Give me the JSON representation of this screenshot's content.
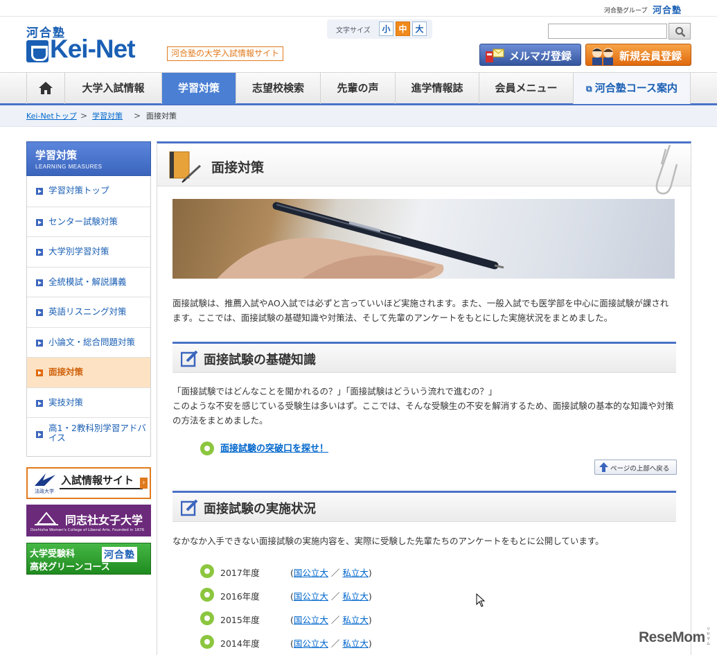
{
  "header": {
    "group_label": "河合塾グループ",
    "group_logo": "河合塾",
    "brand_top": "河合塾",
    "brand_name": "Kei-Net",
    "tagline": "河合塾の大学入試情報サイト",
    "font_size": {
      "label": "文字サイズ",
      "small": "小",
      "medium": "中",
      "large": "大",
      "selected": "中"
    },
    "search": {
      "value": "",
      "placeholder": "",
      "icon": "search-icon"
    },
    "mailmag_label": "メルマガ登録",
    "join_label": "新規会員登録"
  },
  "nav": {
    "home_icon": "home-icon",
    "items": [
      "大学入試情報",
      "学習対策",
      "志望校検索",
      "先輩の声",
      "進学情報誌",
      "会員メニュー",
      "河合塾コース案内"
    ],
    "active": "学習対策"
  },
  "breadcrumb": {
    "home": "Kei-Netトップ",
    "parent": "学習対策",
    "current": "面接対策",
    "separator": ">"
  },
  "sidebar": {
    "title": "学習対策",
    "subtitle": "LEARNING MEASURES",
    "items": [
      "学習対策トップ",
      "センター試験対策",
      "大学別学習対策",
      "全統模試・解説講義",
      "英語リスニング対策",
      "小論文・総合問題対策",
      "面接対策",
      "実技対策",
      "高1・2教科別学習アドバイス"
    ],
    "active": "面接対策"
  },
  "banners": {
    "b1": {
      "title": "入試情報サイト",
      "sub": "法政大学",
      "arrow": "›"
    },
    "b2": {
      "title": "同志社女子大学",
      "sub": "Doshisha Women's College of Liberal Arts, Founded in 1876"
    },
    "b3": {
      "line1": "大学受験科",
      "line2": "高校グリーンコース",
      "logo": "河合塾"
    }
  },
  "main": {
    "title": "面接対策",
    "intro": "面接試験は、推薦入試やAO入試では必ずと言っていいほど実施されます。また、一般入試でも医学部を中心に面接試験が課されます。ここでは、面接試験の基礎知識や対策法、そして先輩のアンケートをもとにした実施状況をまとめました。",
    "section1": {
      "title": "面接試験の基礎知識",
      "quote": "「面接試験ではどんなことを聞かれるの？」「面接試験はどういう流れで進むの？」",
      "body": "このような不安を感じている受験生は多いはず。ここでは、そんな受験生の不安を解消するため、面接試験の基本的な知識や対策の方法をまとめました。",
      "link": "面接試験の突破口を探せ！"
    },
    "pagetop": "ページの上部へ戻る",
    "section2": {
      "title": "面接試験の実施状況",
      "body": "なかなか入手できない面接試験の実施内容を、実際に受験した先輩たちのアンケートをもとに公開しています。",
      "years": [
        {
          "label": "2017年度",
          "public": "国公立大",
          "private": "私立大"
        },
        {
          "label": "2016年度",
          "public": "国公立大",
          "private": "私立大"
        },
        {
          "label": "2015年度",
          "public": "国公立大",
          "private": "私立大"
        },
        {
          "label": "2014年度",
          "public": "国公立大",
          "private": "私立大"
        }
      ],
      "paren_open": "(",
      "slash": "／",
      "paren_close": ")"
    }
  },
  "watermark": {
    "text": "ReseMom",
    "small": "リセマム"
  },
  "colors": {
    "brand": "#1a5fb4",
    "accent": "#4a72c8",
    "orange": "#e0690d",
    "green": "#8cc63f"
  }
}
